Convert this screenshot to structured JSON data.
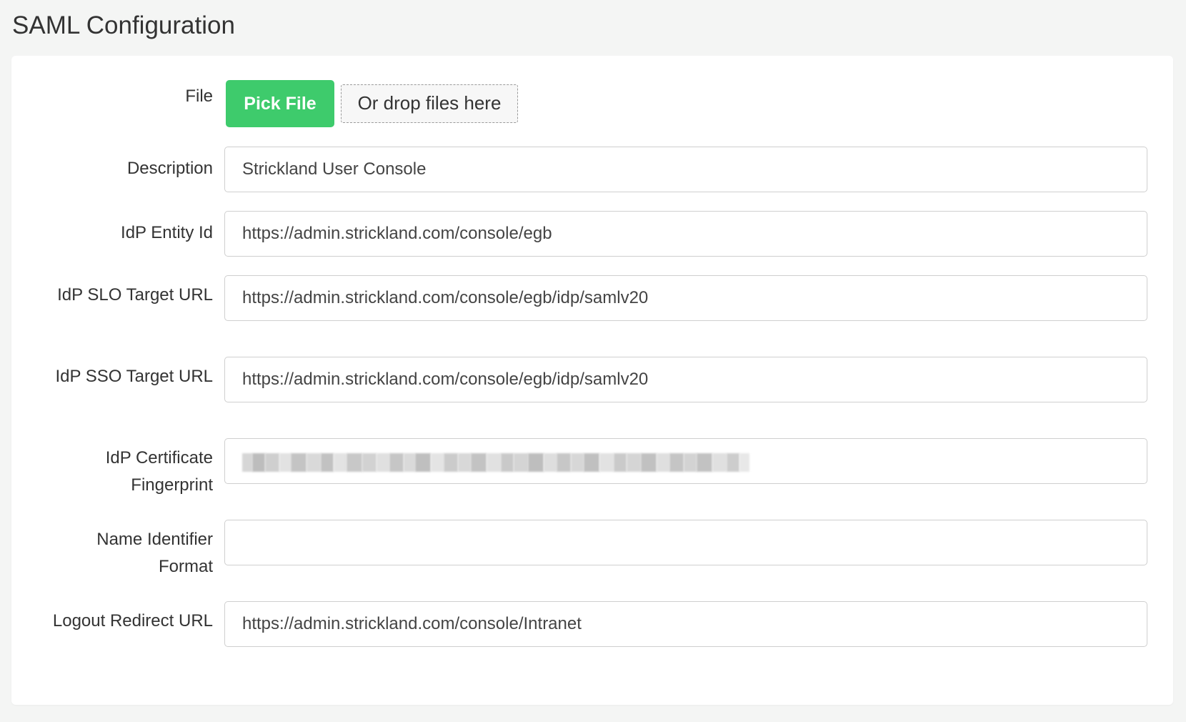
{
  "page": {
    "title": "SAML Configuration"
  },
  "form": {
    "file": {
      "label": "File",
      "button_label": "Pick File",
      "drop_label": "Or drop files here"
    },
    "fields": [
      {
        "label": "Description",
        "value": "Strickland User Console"
      },
      {
        "label": "IdP Entity Id",
        "value": "https://admin.strickland.com/console/egb"
      },
      {
        "label": "IdP SLO Target URL",
        "value": "https://admin.strickland.com/console/egb/idp/samlv20"
      },
      {
        "label": "IdP SSO Target URL",
        "value": "https://admin.strickland.com/console/egb/idp/samlv20"
      },
      {
        "label": "IdP Certificate Fingerprint",
        "value": ""
      },
      {
        "label": "Name Identifier Format",
        "value": ""
      },
      {
        "label": "Logout Redirect URL",
        "value": "https://admin.strickland.com/console/Intranet"
      }
    ]
  },
  "colors": {
    "accent": "#3ecb6c",
    "background": "#f4f5f4",
    "card": "#ffffff",
    "border": "#cfcfcf"
  }
}
